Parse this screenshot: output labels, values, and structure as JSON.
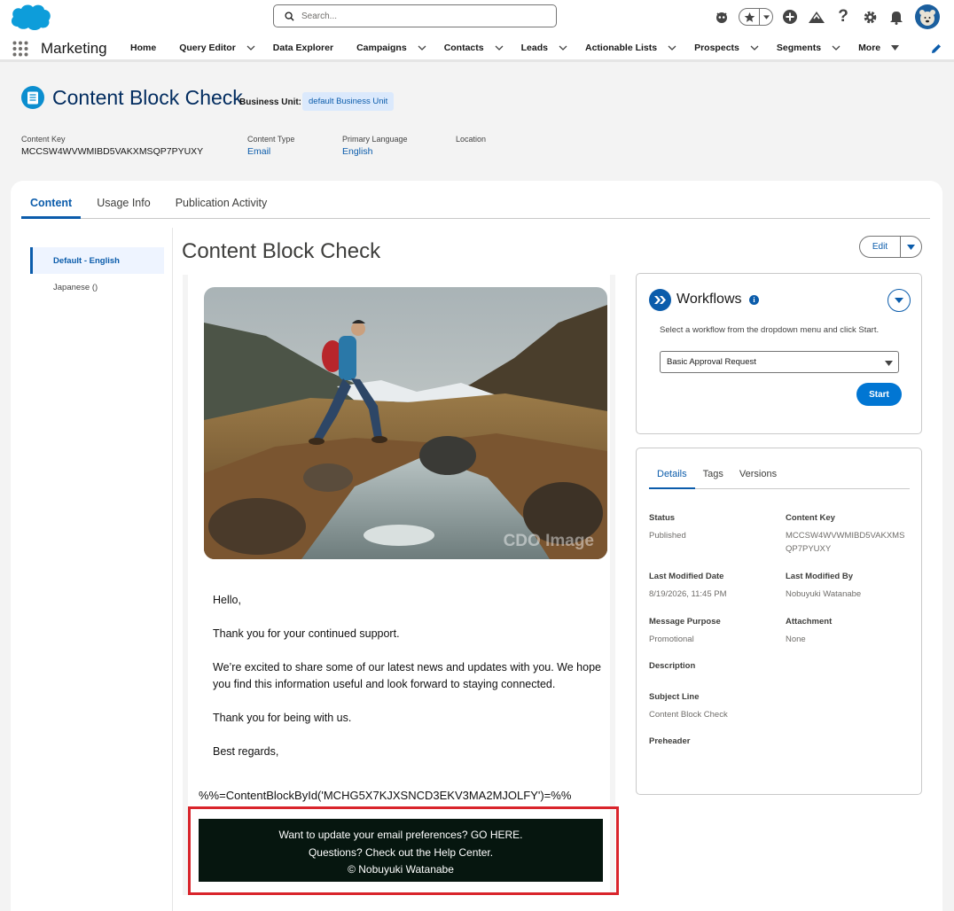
{
  "header": {
    "search_placeholder": "Search..."
  },
  "nav": {
    "app_name": "Marketing",
    "items": [
      {
        "label": "Home",
        "has_menu": false
      },
      {
        "label": "Query Editor",
        "has_menu": true
      },
      {
        "label": "Data Explorer",
        "has_menu": false
      },
      {
        "label": "Campaigns",
        "has_menu": true
      },
      {
        "label": "Contacts",
        "has_menu": true
      },
      {
        "label": "Leads",
        "has_menu": true
      },
      {
        "label": "Actionable Lists",
        "has_menu": true
      },
      {
        "label": "Prospects",
        "has_menu": true
      },
      {
        "label": "Segments",
        "has_menu": true
      },
      {
        "label": "More",
        "has_menu": true
      }
    ]
  },
  "record": {
    "title": "Content Block Check",
    "business_unit_label": "Business Unit:",
    "business_unit": "default Business Unit",
    "fields": {
      "content_key_label": "Content Key",
      "content_key": "MCCSW4WVWMIBD5VAKXMSQP7PYUXY",
      "content_type_label": "Content Type",
      "content_type": "Email",
      "primary_language_label": "Primary Language",
      "primary_language": "English",
      "location_label": "Location"
    }
  },
  "tabs": {
    "content": "Content",
    "usage": "Usage Info",
    "publication": "Publication Activity"
  },
  "languages": {
    "default": "Default - English",
    "japanese": "Japanese ()"
  },
  "content": {
    "title": "Content Block Check",
    "edit_label": "Edit"
  },
  "email": {
    "watermark": "CDO Image",
    "greeting": "Hello,",
    "p1": "Thank you for your continued support.",
    "p2": "We’re excited to share some of our latest news and updates with you. We hope you find this information useful and look forward to staying connected.",
    "p3": "Thank you for being with us.",
    "signoff": "Best regards,",
    "ampscript": "%%=ContentBlockById('MCHG5X7KJXSNCD3EKV3MA2MJOLFY')=%%",
    "footer_line1": "Want to update your email preferences? GO HERE.",
    "footer_line2": "Questions? Check out the Help Center.",
    "footer_line3": "© Nobuyuki Watanabe"
  },
  "workflows": {
    "title": "Workflows",
    "info": "i",
    "help": "Select a workflow from the dropdown menu and click Start.",
    "selected": "Basic Approval Request",
    "start_label": "Start"
  },
  "details": {
    "tabs": {
      "details": "Details",
      "tags": "Tags",
      "versions": "Versions"
    },
    "status_label": "Status",
    "status": "Published",
    "content_key_label": "Content Key",
    "content_key_l1": "MCCSW4WVWMIBD5VAKXMS",
    "content_key_l2": "QP7PYUXY",
    "last_modified_date_label": "Last Modified Date",
    "last_modified_date": "8/19/2026, 11:45 PM",
    "last_modified_by_label": "Last Modified By",
    "last_modified_by": "Nobuyuki Watanabe",
    "message_purpose_label": "Message Purpose",
    "message_purpose": "Promotional",
    "attachment_label": "Attachment",
    "attachment": "None",
    "description_label": "Description",
    "subject_line_label": "Subject Line",
    "subject_line": "Content Block Check",
    "preheader_label": "Preheader"
  },
  "colors": {
    "brand_blue": "#0176d3",
    "link_blue": "#0b5cab",
    "highlight_red": "#d9242b",
    "footer_bg": "#06160f"
  }
}
